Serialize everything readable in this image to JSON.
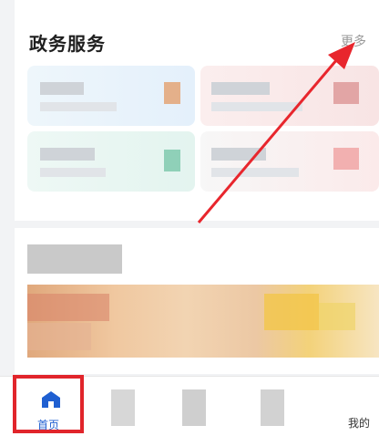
{
  "section": {
    "title": "政务服务",
    "more_label": "更多"
  },
  "tabbar": {
    "items": [
      {
        "label": "首页",
        "icon": "home-icon",
        "active": true
      },
      {
        "label": "",
        "icon": "blurred-icon"
      },
      {
        "label": "",
        "icon": "blurred-icon"
      },
      {
        "label": "",
        "icon": "blurred-icon"
      },
      {
        "label": "我的",
        "icon": "profile-icon"
      }
    ]
  },
  "colors": {
    "accent": "#1f5fd1",
    "highlight": "#e1252b",
    "arrow": "#e8262d"
  }
}
